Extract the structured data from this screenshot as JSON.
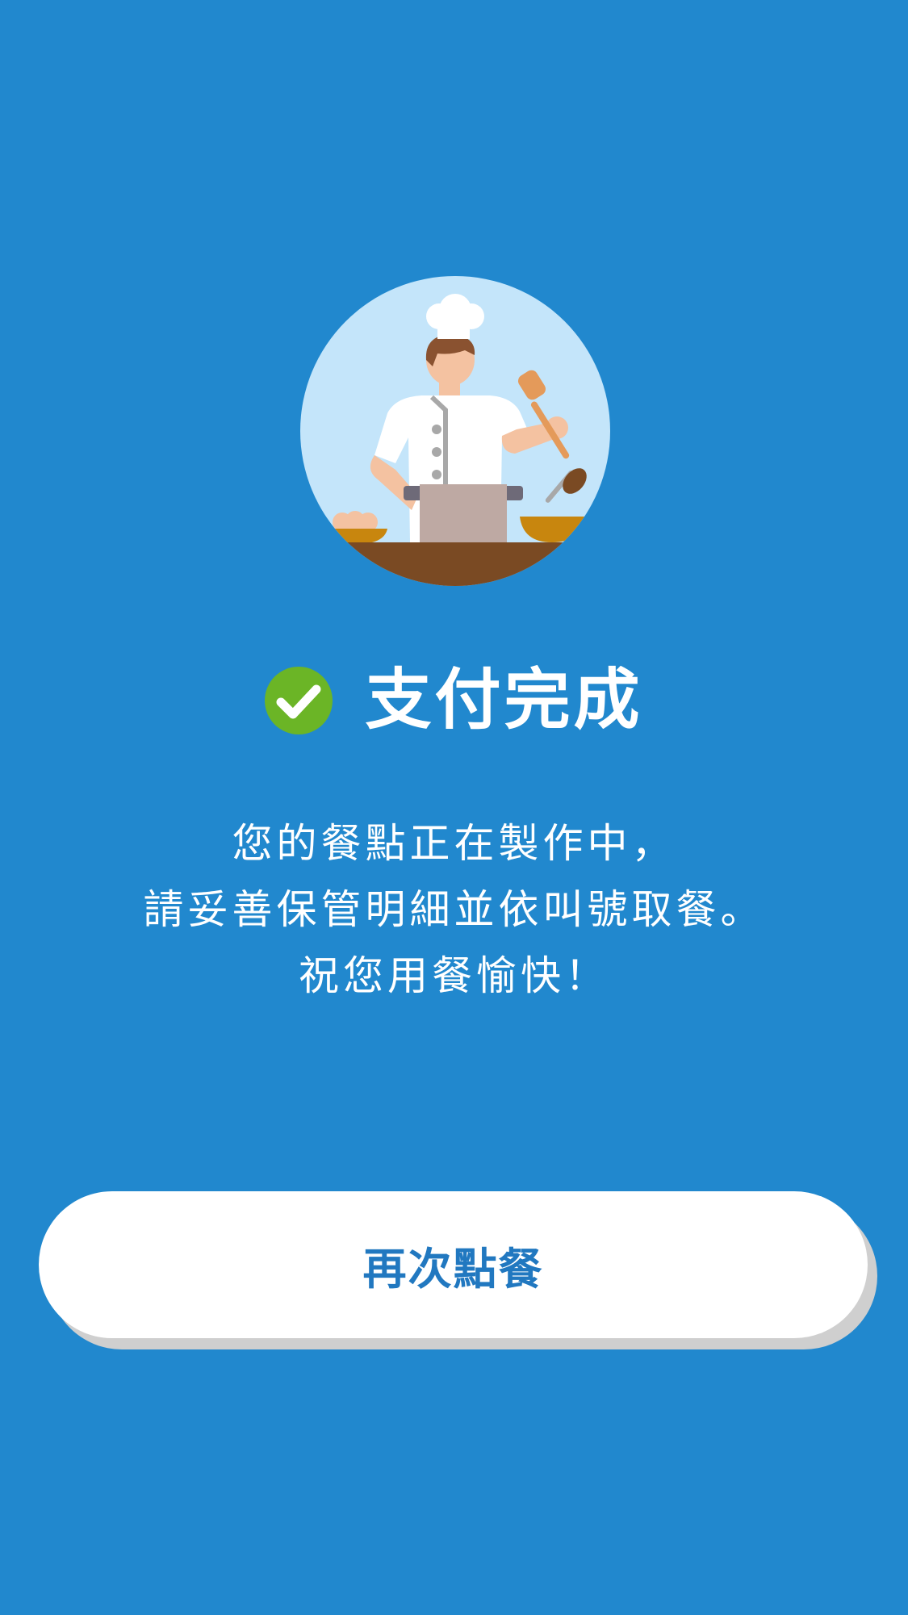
{
  "illustration": {
    "icon": "chef-cooking-icon",
    "circle_color": "#C4E5FA",
    "counter_color": "#7A4A23"
  },
  "status": {
    "icon": "check-circle-icon",
    "icon_color": "#6BB526",
    "title": "支付完成"
  },
  "message": {
    "lines": [
      "您的餐點正在製作中，",
      "請妥善保管明細並依叫號取餐。",
      "祝您用餐愉快！"
    ]
  },
  "actions": {
    "order_again_label": "再次點餐"
  },
  "colors": {
    "background": "#2188CE",
    "button_background": "#FFFFFF",
    "button_text": "#2178C0",
    "button_shadow": "#CFCFCF"
  }
}
